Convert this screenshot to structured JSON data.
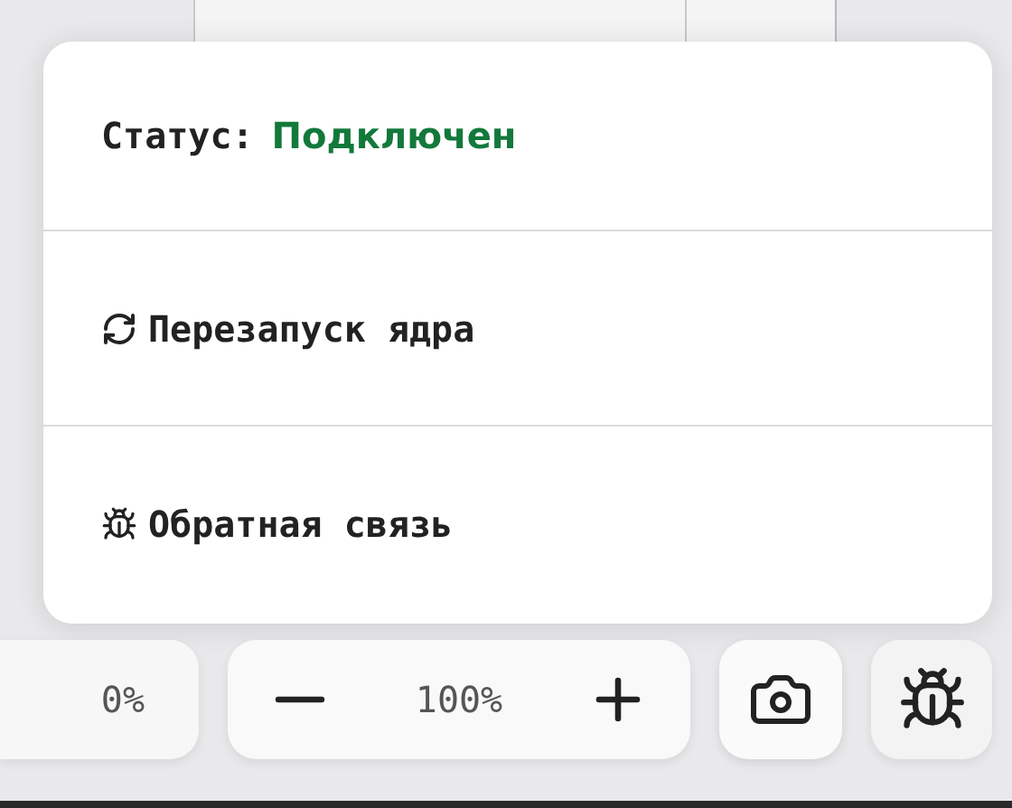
{
  "status": {
    "label": "Статус:",
    "value": "Подключен",
    "connected": true
  },
  "menu_items": [
    {
      "kind": "restart",
      "label": "Перезапуск ядра"
    },
    {
      "kind": "feedback",
      "label": "Обратная связь"
    }
  ],
  "toolbar": {
    "progress": "0%",
    "zoom": "100%"
  }
}
